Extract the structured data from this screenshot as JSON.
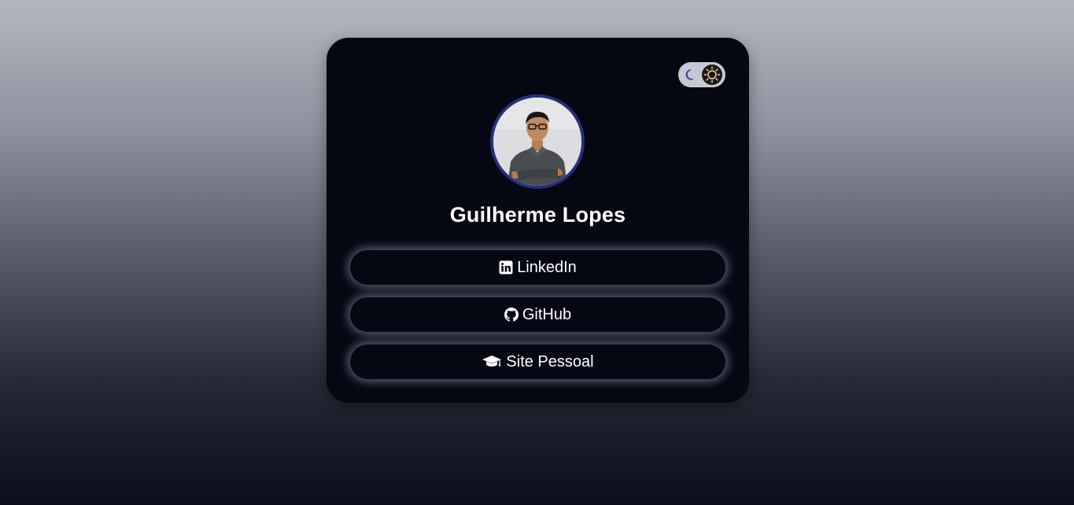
{
  "profile": {
    "name": "Guilherme Lopes"
  },
  "theme_toggle": {
    "state": "dark"
  },
  "links": {
    "linkedin": {
      "label": "LinkedIn",
      "icon": "linkedin-icon"
    },
    "github": {
      "label": "GitHub",
      "icon": "github-icon"
    },
    "site": {
      "label": "Site Pessoal",
      "icon": "graduation-cap-icon"
    }
  },
  "colors": {
    "card_bg": "#050713",
    "avatar_border": "#25307a",
    "toggle_bg": "#c7c9d2",
    "text": "#ffffff"
  }
}
